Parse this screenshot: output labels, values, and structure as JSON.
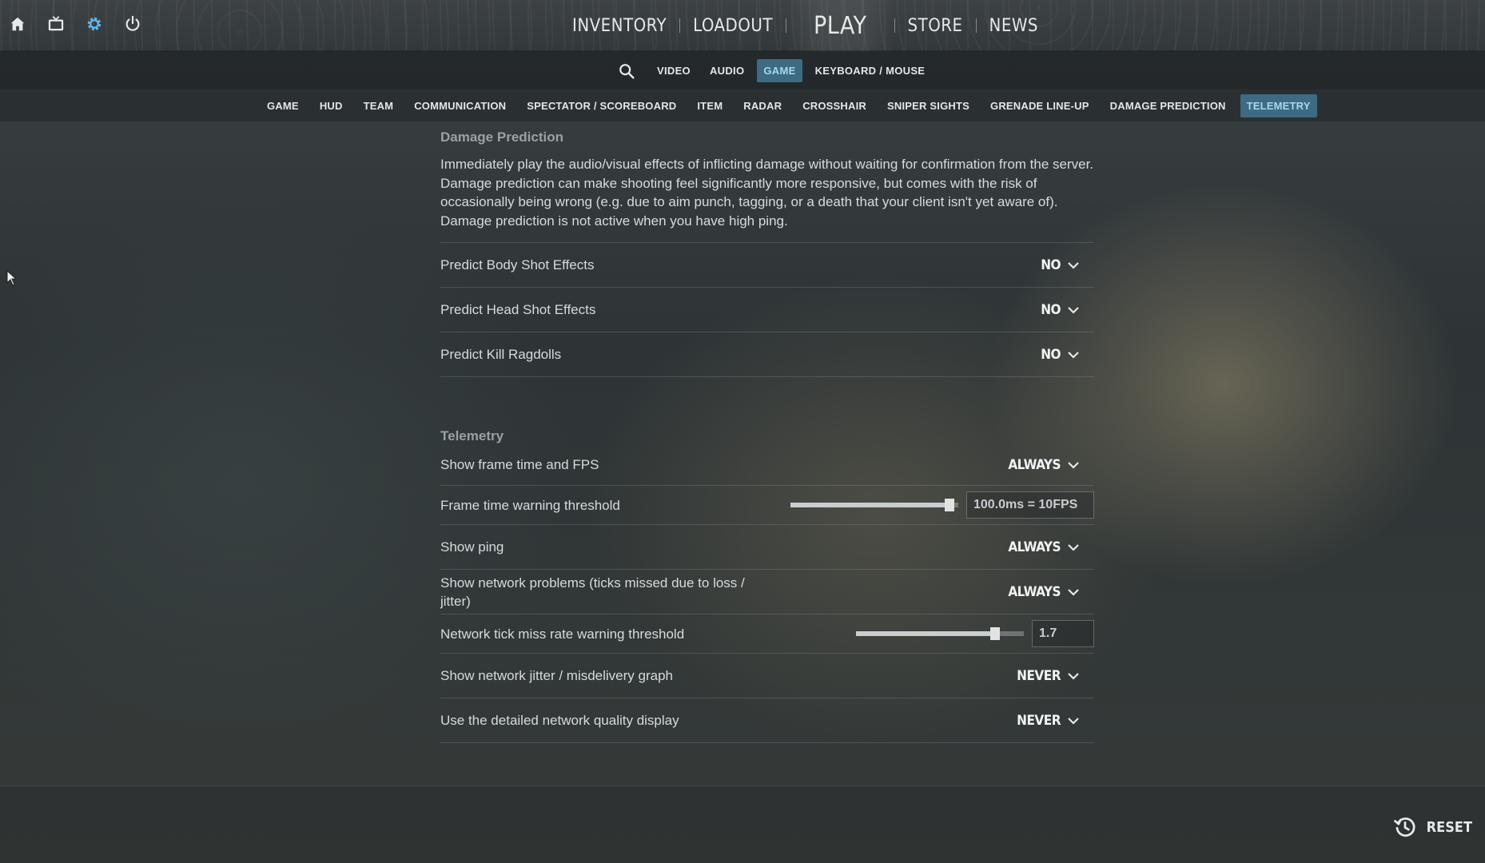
{
  "topbar": {
    "nav": {
      "inventory": "INVENTORY",
      "loadout": "LOADOUT",
      "play": "PLAY",
      "store": "STORE",
      "news": "NEWS"
    }
  },
  "settings_tabs": [
    "VIDEO",
    "AUDIO",
    "GAME",
    "KEYBOARD / MOUSE"
  ],
  "settings_active": "GAME",
  "category_tabs": [
    "GAME",
    "HUD",
    "TEAM",
    "COMMUNICATION",
    "SPECTATOR / SCOREBOARD",
    "ITEM",
    "RADAR",
    "CROSSHAIR",
    "SNIPER SIGHTS",
    "GRENADE LINE-UP",
    "DAMAGE PREDICTION",
    "TELEMETRY"
  ],
  "category_active": "TELEMETRY",
  "damage_prediction": {
    "title": "Damage Prediction",
    "description": "Immediately play the audio/visual effects of inflicting damage without waiting for confirmation from the server. Damage prediction can make shooting feel significantly more responsive, but comes with the risk of occasionally being wrong (e.g. due to aim punch, tagging, or a death that your client isn't yet aware of). Damage prediction is not active when you have high ping.",
    "rows": [
      {
        "label": "Predict Body Shot Effects",
        "value": "NO"
      },
      {
        "label": "Predict Head Shot Effects",
        "value": "NO"
      },
      {
        "label": "Predict Kill Ragdolls",
        "value": "NO"
      }
    ]
  },
  "telemetry": {
    "title": "Telemetry",
    "show_fps": {
      "label": "Show frame time and FPS",
      "value": "ALWAYS"
    },
    "frame_warning": {
      "label": "Frame time warning threshold",
      "value": "100.0ms = 10FPS",
      "level": 0.97
    },
    "show_ping": {
      "label": "Show ping",
      "value": "ALWAYS"
    },
    "show_network_problems": {
      "label": "Show network problems (ticks missed due to loss / jitter)",
      "value": "ALWAYS"
    },
    "tick_miss": {
      "label": "Network tick miss rate warning threshold",
      "value": "1.7",
      "level": 0.83
    },
    "jitter_graph": {
      "label": "Show network jitter / misdelivery graph",
      "value": "NEVER"
    },
    "detailed_quality": {
      "label": "Use the detailed network quality display",
      "value": "NEVER"
    }
  },
  "footer": {
    "reset_label": "RESET"
  },
  "colors": {
    "accent_bg": "#3e6a82",
    "accent_text": "#a5d9f4",
    "settings_icon": "#5fb6ee"
  },
  "icons": [
    "home-icon",
    "tv-icon",
    "gear-icon",
    "power-icon",
    "search-icon",
    "chevron-down-icon",
    "reset-history-icon",
    "mouse-cursor-icon"
  ]
}
